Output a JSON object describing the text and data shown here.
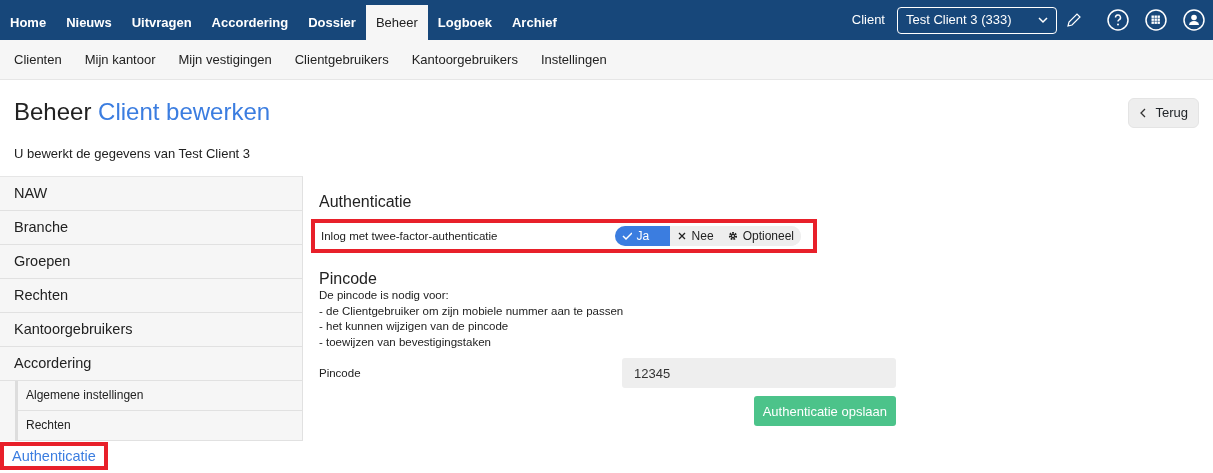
{
  "top_nav": [
    {
      "label": "Home",
      "selected": false
    },
    {
      "label": "Nieuws",
      "selected": false
    },
    {
      "label": "Uitvragen",
      "selected": false
    },
    {
      "label": "Accordering",
      "selected": false
    },
    {
      "label": "Dossier",
      "selected": false
    },
    {
      "label": "Beheer",
      "selected": true
    },
    {
      "label": "Logboek",
      "selected": false
    },
    {
      "label": "Archief",
      "selected": false
    }
  ],
  "client_label": "Client",
  "client_select": {
    "value": "Test Client 3 (333)"
  },
  "sub_nav": [
    "Clienten",
    "Mijn kantoor",
    "Mijn vestigingen",
    "Clientgebruikers",
    "Kantoorgebruikers",
    "Instellingen"
  ],
  "page_title": {
    "section": "Beheer",
    "subtitle": "Client bewerken"
  },
  "back_button": "Terug",
  "intro": "U bewerkt de gegevens van Test Client 3",
  "sidebar": {
    "items": [
      {
        "label": "NAW",
        "selected": false
      },
      {
        "label": "Branche",
        "selected": false
      },
      {
        "label": "Groepen",
        "selected": false
      },
      {
        "label": "Rechten",
        "selected": false
      },
      {
        "label": "Kantoorgebruikers",
        "selected": false
      },
      {
        "label": "Accordering",
        "selected": false,
        "children": [
          {
            "label": "Algemene instellingen",
            "selected": false
          },
          {
            "label": "Rechten",
            "selected": false
          }
        ]
      },
      {
        "label": "Authenticatie",
        "selected": true,
        "highlighted": true
      }
    ]
  },
  "auth": {
    "heading": "Authenticatie",
    "row": {
      "label": "Inlog met twee-factor-authenticatie",
      "highlighted": true,
      "options": [
        {
          "label": "Ja",
          "kind": "check",
          "selected": true
        },
        {
          "label": "Nee",
          "kind": "cross",
          "selected": false
        },
        {
          "label": "Optioneel",
          "kind": "gear",
          "selected": false
        }
      ]
    }
  },
  "pincode": {
    "heading": "Pincode",
    "description": [
      "De pincode is nodig voor:",
      "- de Clientgebruiker om zijn mobiele nummer aan te passen",
      "- het kunnen wijzigen van de pincode",
      "- toewijzen van bevestigingstaken"
    ],
    "field_label": "Pincode",
    "field_value": "12345"
  },
  "save_button": "Authenticatie opslaan"
}
